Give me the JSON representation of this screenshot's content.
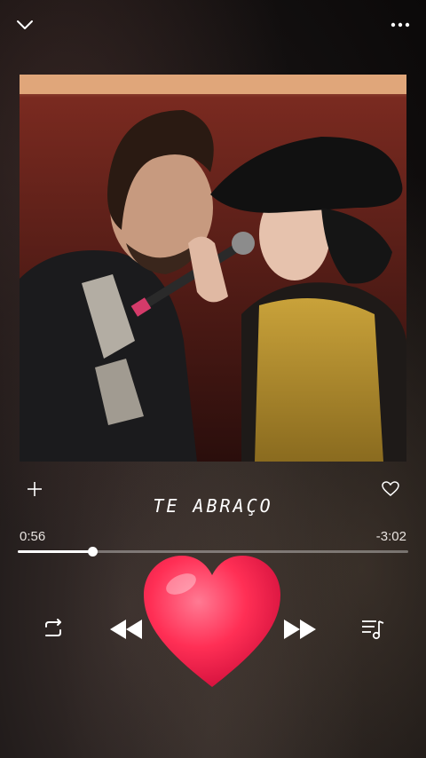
{
  "track": {
    "title": "TE ABRAÇO",
    "elapsed": "0:56",
    "remaining": "-3:02",
    "progress_fraction": 0.19
  },
  "icons": {
    "collapse": "chevron-down-icon",
    "more": "more-dots-icon",
    "add": "plus-icon",
    "like": "heart-outline-icon",
    "repeat": "repeat-icon",
    "previous": "rewind-icon",
    "next": "fast-forward-icon",
    "queue": "queue-music-icon",
    "overlay": "red-heart-emoji"
  },
  "colors": {
    "accent_heart": "#ff2f55",
    "text": "#ffffff"
  }
}
